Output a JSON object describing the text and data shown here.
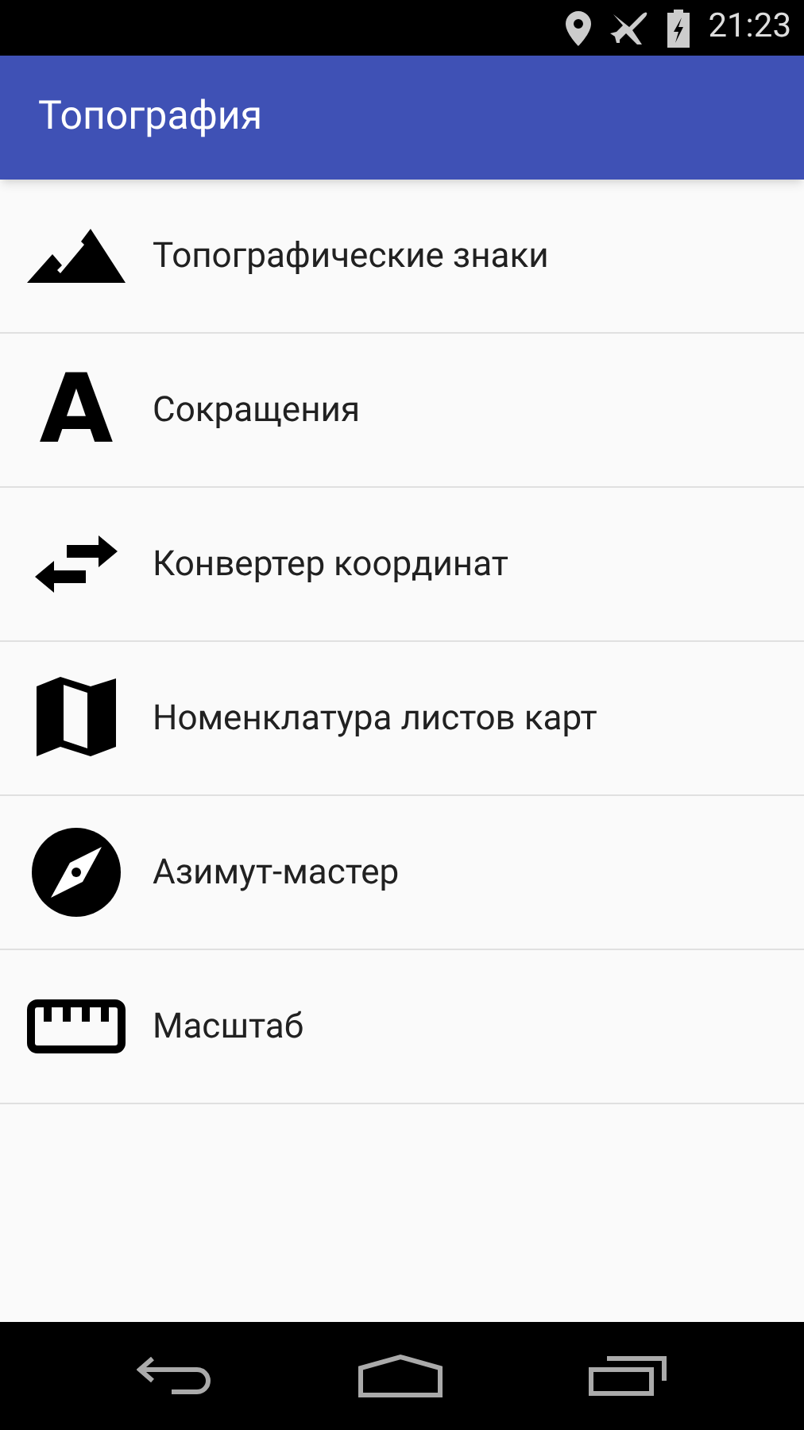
{
  "status_bar": {
    "time": "21:23"
  },
  "app_bar": {
    "title": "Топография"
  },
  "items": [
    {
      "kind": "mountains",
      "label": "Топографические знаки"
    },
    {
      "kind": "letter",
      "glyph": "A",
      "label": "Сокращения"
    },
    {
      "kind": "swap",
      "label": "Конвертер координат"
    },
    {
      "kind": "map",
      "label": "Номенклатура листов карт"
    },
    {
      "kind": "compass",
      "label": "Азимут-мастер"
    },
    {
      "kind": "ruler",
      "label": "Масштаб"
    }
  ]
}
